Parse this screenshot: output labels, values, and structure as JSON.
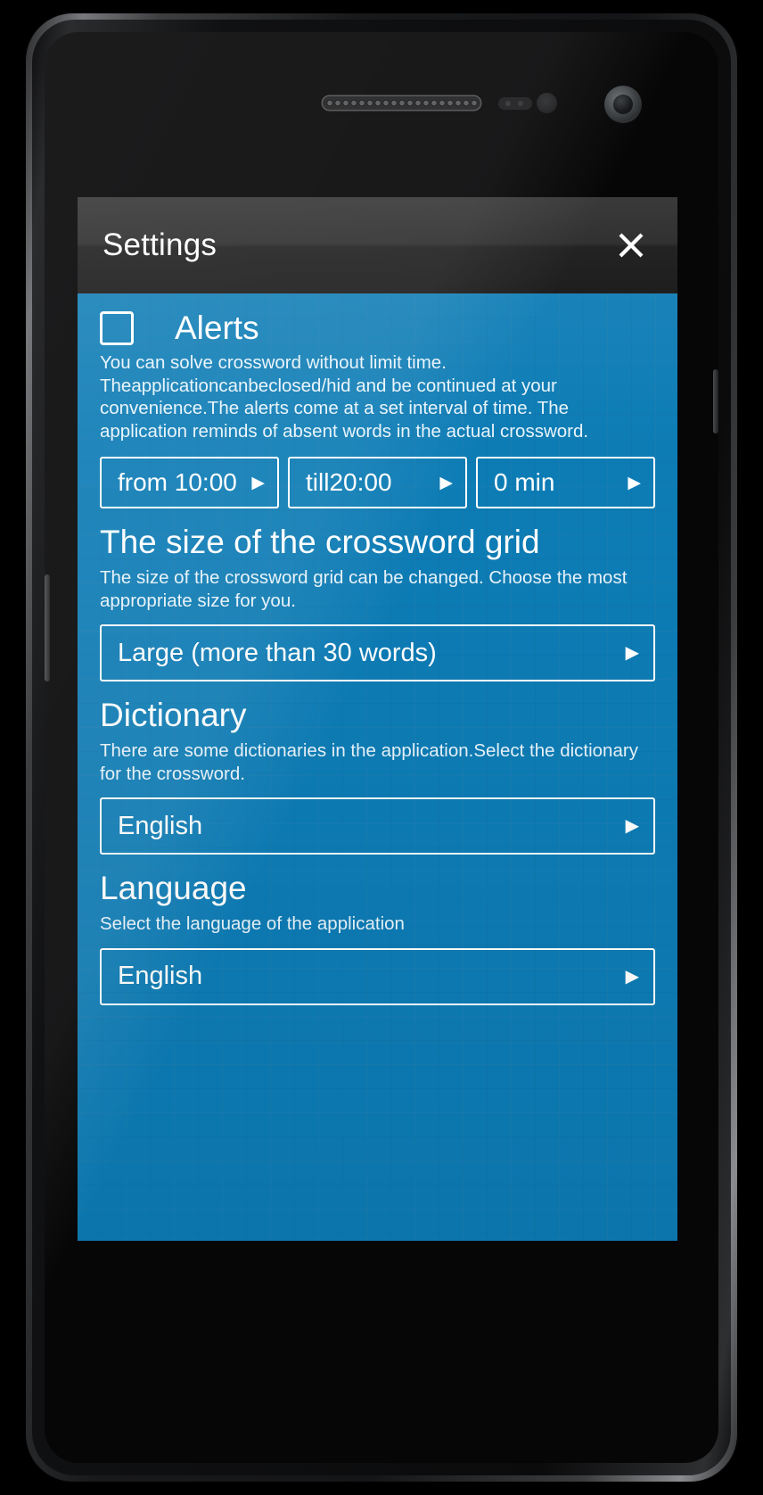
{
  "app": {
    "title": "Settings",
    "close_icon": "close-x-icon"
  },
  "alerts": {
    "label": "Alerts",
    "checked": false,
    "description": "You can solve crossword without limit time. Theapplicationcanbeclosed/hid and be continued at your convenience.The alerts come at a set interval of time. The application reminds of absent words in the actual crossword.",
    "from_time": "from 10:00",
    "till_time": "till20:00",
    "interval": "0 min",
    "arrow_icon": "chevron-right-icon"
  },
  "grid_size": {
    "title": "The size of the crossword grid",
    "description": "The size of the crossword grid can be changed. Choose the most appropriate size for you.",
    "value": "Large (more than 30 words)",
    "arrow_icon": "chevron-right-icon"
  },
  "dictionary": {
    "title": "Dictionary",
    "description": "There are some dictionaries in the application.Select the dictionary for the crossword.",
    "value": "English",
    "arrow_icon": "chevron-right-icon"
  },
  "language": {
    "title": "Language",
    "description": "Select the language of the application",
    "value": "English",
    "arrow_icon": "chevron-right-icon"
  },
  "colors": {
    "accent_blue": "#0d7cb5",
    "action_bar": "#2d2d2d",
    "text_white": "#ffffff",
    "device_black": "#000000"
  },
  "device": {
    "earpiece_icon": "earpiece-speaker-icon",
    "front_camera_icon": "front-camera-icon",
    "proximity_sensor_icon": "proximity-sensor-icon",
    "light_sensor_icon": "light-sensor-icon"
  }
}
